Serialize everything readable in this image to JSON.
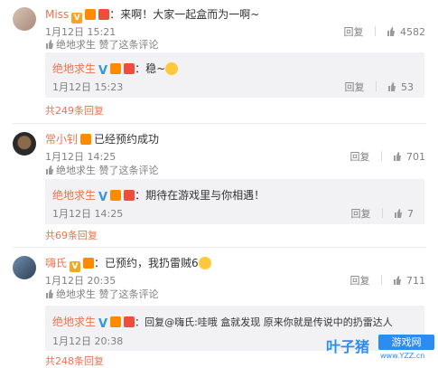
{
  "comments": [
    {
      "user": "Miss",
      "text": "：来啊！大家一起盒而为一啊~",
      "time": "1月12日 15:21",
      "liked_by": "绝地求生 赞了这条评论",
      "reply_label": "回复",
      "likes": "4582",
      "reply": {
        "user": "绝地求生",
        "text": "：稳~",
        "time": "1月12日 15:23",
        "reply_label": "回复",
        "likes": "53"
      },
      "more": "共249条回复"
    },
    {
      "user": "常小钊",
      "text": "已经预约成功",
      "time": "1月12日 14:25",
      "liked_by": "绝地求生 赞了这条评论",
      "reply_label": "回复",
      "likes": "701",
      "reply": {
        "user": "绝地求生",
        "text": "：期待在游戏里与你相遇！",
        "time": "1月12日 14:25",
        "reply_label": "回复",
        "likes": "7"
      },
      "more": "共69条回复"
    },
    {
      "user": "嗨氏",
      "text": "：已预约，我扔雷贼6",
      "time": "1月12日 20:35",
      "liked_by": "绝地求生 赞了这条评论",
      "reply_label": "回复",
      "likes": "711",
      "reply": {
        "user": "绝地求生",
        "text": "：回复@嗨氏:哇哦  盒就发现  原来你就是传说中的扔雷达人",
        "time": "1月12日 20:38",
        "reply_label": "回复",
        "likes": ""
      },
      "more": "共248条回复"
    }
  ],
  "watermark": {
    "name": "叶子猪",
    "tag": "游戏网",
    "url": "www.YZZ.cn"
  }
}
